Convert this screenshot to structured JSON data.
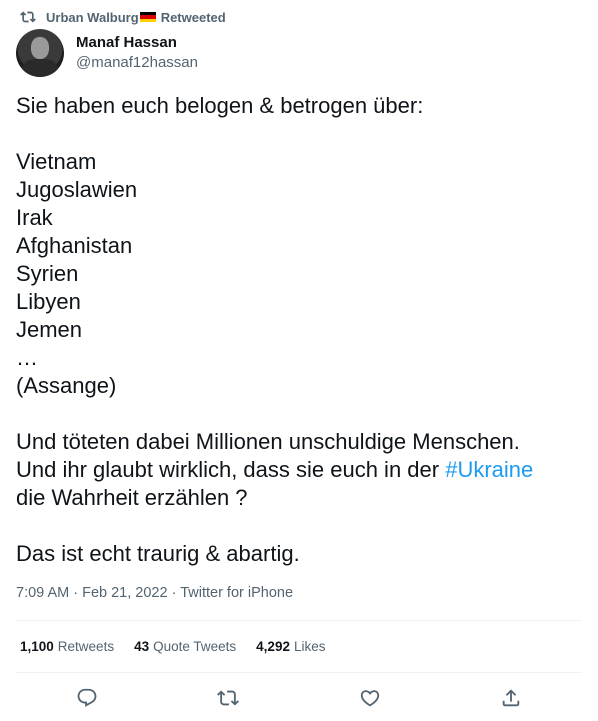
{
  "retweet_banner": {
    "icon": "retweet-icon",
    "retweeter": "Urban Walburg",
    "flag": "german-flag-emoji",
    "label": "Retweeted"
  },
  "author": {
    "avatar": "avatar",
    "display_name": "Manaf Hassan",
    "handle": "@manaf12hassan"
  },
  "tweet": {
    "text_before_hashtag": "Sie haben euch belogen & betrogen über:\n\nVietnam\nJugoslawien\nIrak\nAfghanistan\nSyrien\nLibyen\nJemen\n…\n(Assange)\n\nUnd töteten dabei Millionen unschuldige Menschen.\nUnd ihr glaubt wirklich, dass sie euch in der ",
    "hashtag": "#Ukraine",
    "text_after_hashtag": "\ndie Wahrheit erzählen ?\n\nDas ist echt traurig & abartig.",
    "hashtag_color": "#1d9bf0"
  },
  "meta": {
    "time": "7:09 AM",
    "date": "Feb 21, 2022",
    "source": "Twitter for iPhone"
  },
  "stats": {
    "retweets_count": "1,100",
    "retweets_label": "Retweets",
    "quotes_count": "43",
    "quotes_label": "Quote Tweets",
    "likes_count": "4,292",
    "likes_label": "Likes"
  },
  "actions": [
    "reply-icon",
    "retweet-icon",
    "like-icon",
    "share-icon"
  ]
}
